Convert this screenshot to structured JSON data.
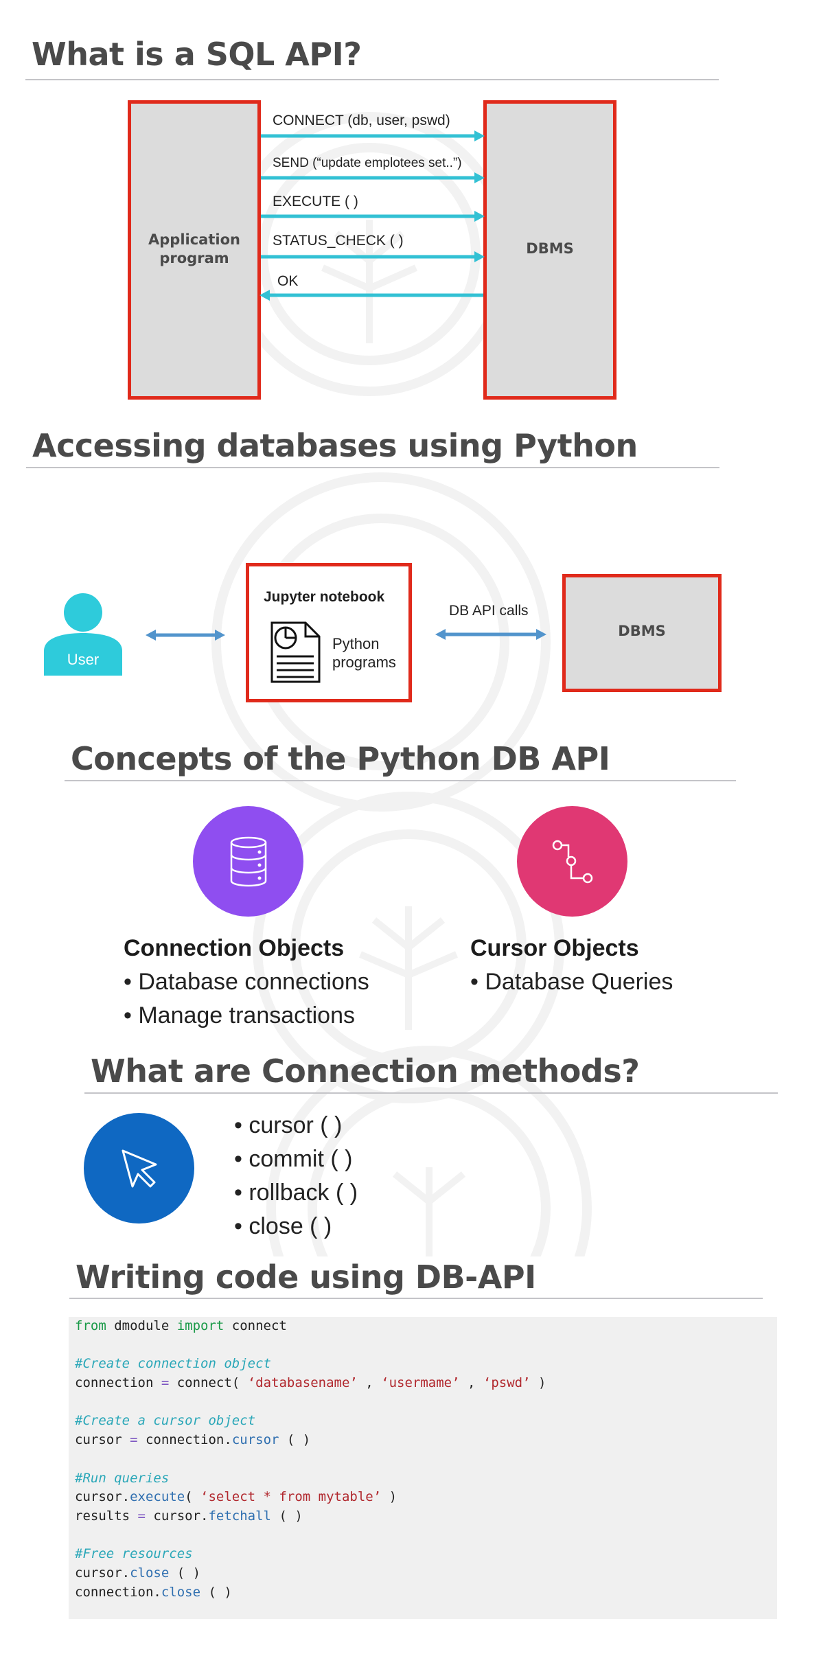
{
  "section1": {
    "title": "What is a SQL API?",
    "left_box": "Application program",
    "right_box": "DBMS",
    "calls": [
      {
        "label": "CONNECT (db, user, pswd)",
        "direction": "right"
      },
      {
        "label": "SEND (“update emplotees set..”)",
        "direction": "right"
      },
      {
        "label": "EXECUTE ( )",
        "direction": "right"
      },
      {
        "label": "STATUS_CHECK ( )",
        "direction": "right"
      },
      {
        "label": "OK",
        "direction": "left"
      }
    ]
  },
  "section2": {
    "title": "Accessing databases using Python",
    "user_label": "User",
    "notebook_title": "Jupyter notebook",
    "notebook_caption_line1": "Python",
    "notebook_caption_line2": "programs",
    "api_label": "DB API calls",
    "dbms_label": "DBMS"
  },
  "section3": {
    "title": "Concepts of the Python DB API",
    "connection": {
      "heading": "Connection Objects",
      "bullets": [
        "• Database connections",
        "• Manage transactions"
      ],
      "icon": "database-icon",
      "color": "#8f4ef0"
    },
    "cursor": {
      "heading": "Cursor Objects",
      "bullets": [
        "• Database Queries"
      ],
      "icon": "flow-icon",
      "color": "#e03873"
    }
  },
  "section4": {
    "title": "What are Connection methods?",
    "icon": "cursor-pointer-icon",
    "color": "#0f68c2",
    "methods": [
      "• cursor ( )",
      "• commit ( )",
      "• rollback ( )",
      "• close ( )"
    ]
  },
  "section5": {
    "title": "Writing code using DB-API",
    "code": {
      "l1": {
        "kw1": "from",
        "t1": " dmodule ",
        "kw2": "import",
        "t2": " connect"
      },
      "c1": "#Create connection object",
      "l2": {
        "t1": "connection ",
        "op": "=",
        "t2": " connect( ",
        "s1": "‘databasename’",
        "t3": " , ",
        "s2": "‘usermame’",
        "t4": " , ",
        "s3": "‘pswd’",
        "t5": " )"
      },
      "c2": "#Create a cursor object",
      "l3": {
        "t1": "cursor ",
        "op": "=",
        "t2": " connection.",
        "m": "cursor",
        "t3": " ( )"
      },
      "c3": "#Run queries",
      "l4": {
        "t1": "cursor.",
        "m": "execute",
        "t2": "( ",
        "s": "‘select * from mytable’",
        "t3": " )"
      },
      "l5": {
        "t1": "results ",
        "op": "=",
        "t2": " cursor.",
        "m": "fetchall",
        "t3": " ( )"
      },
      "c4": "#Free resources",
      "l6": {
        "t1": "cursor.",
        "m": "close",
        "t2": " ( )"
      },
      "l7": {
        "t1": "connection.",
        "m": "close",
        "t2": " ( )"
      }
    }
  },
  "colors": {
    "arrow_teal": "#33c1d4",
    "arrow_blue": "#5294cc",
    "box_border": "#e02a1b",
    "box_fill": "#dcdcdc",
    "heading": "#4a4a4a",
    "user_icon": "#2ecbdb"
  }
}
